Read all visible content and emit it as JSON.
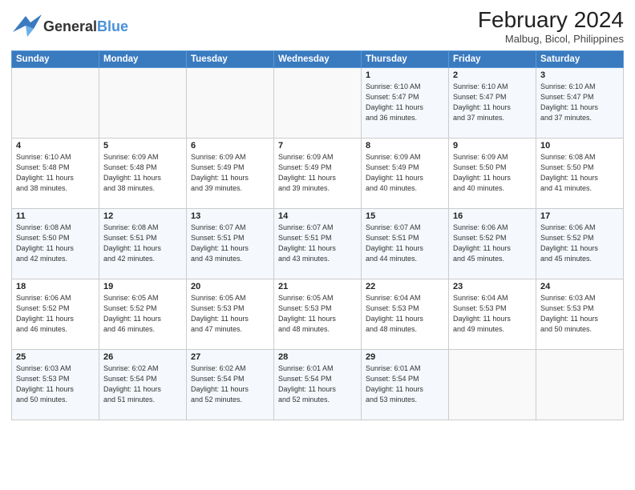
{
  "header": {
    "logo_general": "General",
    "logo_blue": "Blue",
    "month_year": "February 2024",
    "location": "Malbug, Bicol, Philippines"
  },
  "weekdays": [
    "Sunday",
    "Monday",
    "Tuesday",
    "Wednesday",
    "Thursday",
    "Friday",
    "Saturday"
  ],
  "weeks": [
    [
      {
        "day": "",
        "info": ""
      },
      {
        "day": "",
        "info": ""
      },
      {
        "day": "",
        "info": ""
      },
      {
        "day": "",
        "info": ""
      },
      {
        "day": "1",
        "info": "Sunrise: 6:10 AM\nSunset: 5:47 PM\nDaylight: 11 hours\nand 36 minutes."
      },
      {
        "day": "2",
        "info": "Sunrise: 6:10 AM\nSunset: 5:47 PM\nDaylight: 11 hours\nand 37 minutes."
      },
      {
        "day": "3",
        "info": "Sunrise: 6:10 AM\nSunset: 5:47 PM\nDaylight: 11 hours\nand 37 minutes."
      }
    ],
    [
      {
        "day": "4",
        "info": "Sunrise: 6:10 AM\nSunset: 5:48 PM\nDaylight: 11 hours\nand 38 minutes."
      },
      {
        "day": "5",
        "info": "Sunrise: 6:09 AM\nSunset: 5:48 PM\nDaylight: 11 hours\nand 38 minutes."
      },
      {
        "day": "6",
        "info": "Sunrise: 6:09 AM\nSunset: 5:49 PM\nDaylight: 11 hours\nand 39 minutes."
      },
      {
        "day": "7",
        "info": "Sunrise: 6:09 AM\nSunset: 5:49 PM\nDaylight: 11 hours\nand 39 minutes."
      },
      {
        "day": "8",
        "info": "Sunrise: 6:09 AM\nSunset: 5:49 PM\nDaylight: 11 hours\nand 40 minutes."
      },
      {
        "day": "9",
        "info": "Sunrise: 6:09 AM\nSunset: 5:50 PM\nDaylight: 11 hours\nand 40 minutes."
      },
      {
        "day": "10",
        "info": "Sunrise: 6:08 AM\nSunset: 5:50 PM\nDaylight: 11 hours\nand 41 minutes."
      }
    ],
    [
      {
        "day": "11",
        "info": "Sunrise: 6:08 AM\nSunset: 5:50 PM\nDaylight: 11 hours\nand 42 minutes."
      },
      {
        "day": "12",
        "info": "Sunrise: 6:08 AM\nSunset: 5:51 PM\nDaylight: 11 hours\nand 42 minutes."
      },
      {
        "day": "13",
        "info": "Sunrise: 6:07 AM\nSunset: 5:51 PM\nDaylight: 11 hours\nand 43 minutes."
      },
      {
        "day": "14",
        "info": "Sunrise: 6:07 AM\nSunset: 5:51 PM\nDaylight: 11 hours\nand 43 minutes."
      },
      {
        "day": "15",
        "info": "Sunrise: 6:07 AM\nSunset: 5:51 PM\nDaylight: 11 hours\nand 44 minutes."
      },
      {
        "day": "16",
        "info": "Sunrise: 6:06 AM\nSunset: 5:52 PM\nDaylight: 11 hours\nand 45 minutes."
      },
      {
        "day": "17",
        "info": "Sunrise: 6:06 AM\nSunset: 5:52 PM\nDaylight: 11 hours\nand 45 minutes."
      }
    ],
    [
      {
        "day": "18",
        "info": "Sunrise: 6:06 AM\nSunset: 5:52 PM\nDaylight: 11 hours\nand 46 minutes."
      },
      {
        "day": "19",
        "info": "Sunrise: 6:05 AM\nSunset: 5:52 PM\nDaylight: 11 hours\nand 46 minutes."
      },
      {
        "day": "20",
        "info": "Sunrise: 6:05 AM\nSunset: 5:53 PM\nDaylight: 11 hours\nand 47 minutes."
      },
      {
        "day": "21",
        "info": "Sunrise: 6:05 AM\nSunset: 5:53 PM\nDaylight: 11 hours\nand 48 minutes."
      },
      {
        "day": "22",
        "info": "Sunrise: 6:04 AM\nSunset: 5:53 PM\nDaylight: 11 hours\nand 48 minutes."
      },
      {
        "day": "23",
        "info": "Sunrise: 6:04 AM\nSunset: 5:53 PM\nDaylight: 11 hours\nand 49 minutes."
      },
      {
        "day": "24",
        "info": "Sunrise: 6:03 AM\nSunset: 5:53 PM\nDaylight: 11 hours\nand 50 minutes."
      }
    ],
    [
      {
        "day": "25",
        "info": "Sunrise: 6:03 AM\nSunset: 5:53 PM\nDaylight: 11 hours\nand 50 minutes."
      },
      {
        "day": "26",
        "info": "Sunrise: 6:02 AM\nSunset: 5:54 PM\nDaylight: 11 hours\nand 51 minutes."
      },
      {
        "day": "27",
        "info": "Sunrise: 6:02 AM\nSunset: 5:54 PM\nDaylight: 11 hours\nand 52 minutes."
      },
      {
        "day": "28",
        "info": "Sunrise: 6:01 AM\nSunset: 5:54 PM\nDaylight: 11 hours\nand 52 minutes."
      },
      {
        "day": "29",
        "info": "Sunrise: 6:01 AM\nSunset: 5:54 PM\nDaylight: 11 hours\nand 53 minutes."
      },
      {
        "day": "",
        "info": ""
      },
      {
        "day": "",
        "info": ""
      }
    ]
  ]
}
